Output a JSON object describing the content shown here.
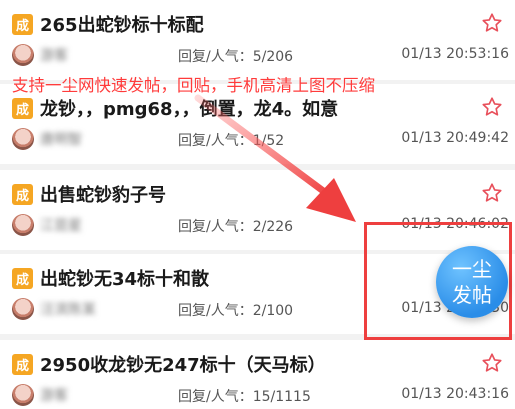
{
  "banner": {
    "text": "支持一尘网快速发帖，回贴，手机高清上图不压缩",
    "color": "#ff3b3b"
  },
  "fab": {
    "line1": "一尘",
    "line2": "发帖",
    "color": "#2a8de8"
  },
  "badge_text": "成",
  "posts": [
    {
      "title": "265出蛇钞标十标配",
      "user": "游客",
      "stats": "回复/人气：5/206",
      "time": "01/13 20:53:16"
    },
    {
      "title": "龙钞，，pmg68，，倒置，龙4。如意",
      "user": "唐明智",
      "stats": "回复/人气：1/52",
      "time": "01/13 20:49:42"
    },
    {
      "title": "出售蛇钞豹子号",
      "user": "江昆星",
      "stats": "回复/人气：2/226",
      "time": "01/13 20:46:02"
    },
    {
      "title": "出蛇钞无34标十和散",
      "user": "汪滨陈某",
      "stats": "回复/人气：2/100",
      "time": "01/13 20:40:30"
    },
    {
      "title": "2950收龙钞无247标十（天马标）",
      "user": "游客",
      "stats": "回复/人气：15/1115",
      "time": "01/13 20:43:16"
    }
  ]
}
